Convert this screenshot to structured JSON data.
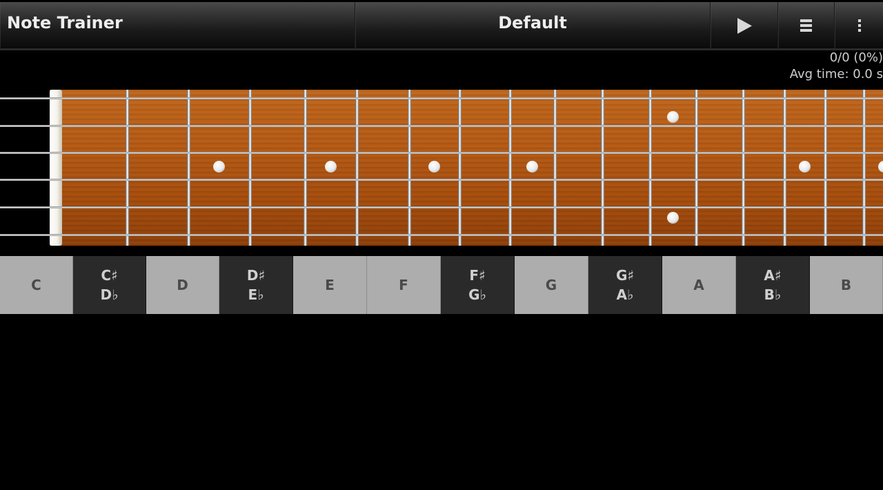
{
  "actionbar": {
    "app_title": "Note Trainer",
    "preset_title": "Default",
    "play_icon": "play-icon",
    "menu_icon": "list-menu-icon",
    "overflow_icon": "overflow-menu-icon"
  },
  "stats": {
    "score": "0/0 (0%)",
    "avg_time": "Avg time: 0.0 s"
  },
  "fretboard": {
    "strings": 6,
    "frets_visible": 16,
    "inlay_frets": [
      3,
      5,
      7,
      9,
      12,
      15,
      17
    ],
    "double_inlay_fret": 12
  },
  "note_keys": [
    {
      "id": "c",
      "top": "C",
      "bottom": "",
      "type": "natural"
    },
    {
      "id": "c-sharp",
      "top": "C♯",
      "bottom": "D♭",
      "type": "accidental"
    },
    {
      "id": "d",
      "top": "D",
      "bottom": "",
      "type": "natural"
    },
    {
      "id": "d-sharp",
      "top": "D♯",
      "bottom": "E♭",
      "type": "accidental"
    },
    {
      "id": "e",
      "top": "E",
      "bottom": "",
      "type": "natural"
    },
    {
      "id": "f",
      "top": "F",
      "bottom": "",
      "type": "natural"
    },
    {
      "id": "f-sharp",
      "top": "F♯",
      "bottom": "G♭",
      "type": "accidental"
    },
    {
      "id": "g",
      "top": "G",
      "bottom": "",
      "type": "natural"
    },
    {
      "id": "g-sharp",
      "top": "G♯",
      "bottom": "A♭",
      "type": "accidental"
    },
    {
      "id": "a",
      "top": "A",
      "bottom": "",
      "type": "natural"
    },
    {
      "id": "a-sharp",
      "top": "A♯",
      "bottom": "B♭",
      "type": "accidental"
    },
    {
      "id": "b",
      "top": "B",
      "bottom": "",
      "type": "natural"
    }
  ],
  "colors": {
    "natural_key": "#adadad",
    "accidental_key": "#2a2a2a",
    "wood": "#b55a14"
  }
}
